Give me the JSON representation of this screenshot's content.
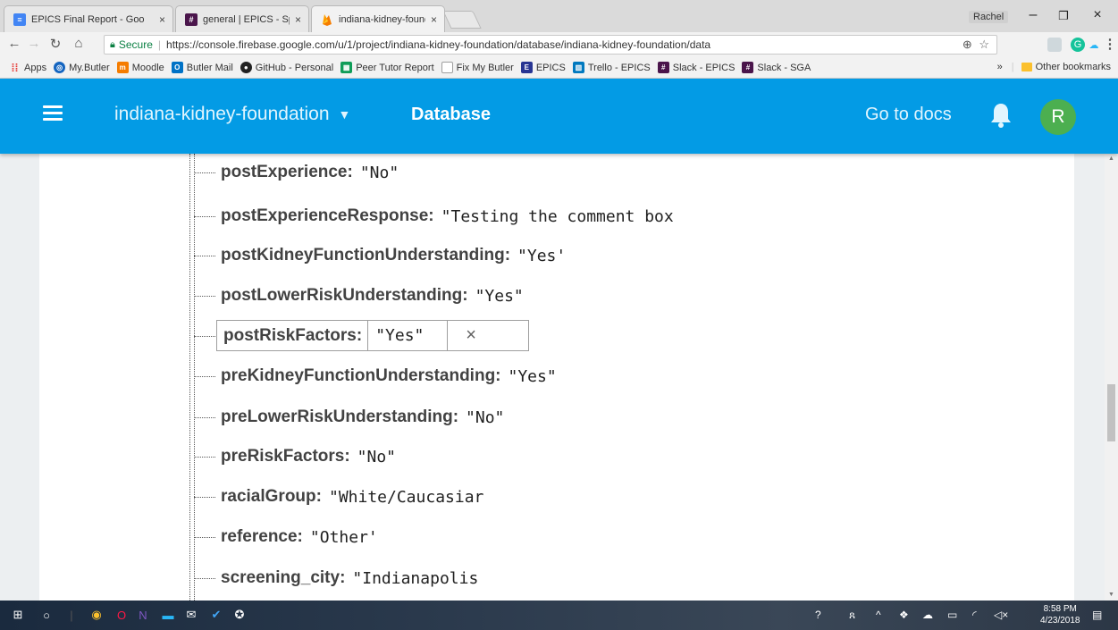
{
  "browser": {
    "tabs": [
      {
        "title": "EPICS Final Report - Goo",
        "favicon": "docs-icon",
        "color": "#4285f4"
      },
      {
        "title": "general | EPICS - Spring",
        "favicon": "slack-icon",
        "color": "#4a154b"
      },
      {
        "title": "indiana-kidney-foundatic",
        "favicon": "firebase-icon",
        "color": "#ffa000"
      }
    ],
    "profile_name": "Rachel",
    "address": {
      "secure_label": "Secure",
      "url": "https://console.firebase.google.com/u/1/project/indiana-kidney-foundation/database/indiana-kidney-foundation/data"
    },
    "bookmarks": [
      {
        "label": "Apps",
        "icon": "apps-grid-icon",
        "color": "#e53935"
      },
      {
        "label": "My.Butler",
        "icon": "mybutler-icon",
        "color": "#1565c0"
      },
      {
        "label": "Moodle",
        "icon": "moodle-icon",
        "color": "#f57c00"
      },
      {
        "label": "Butler Mail",
        "icon": "outlook-icon",
        "color": "#0072c6"
      },
      {
        "label": "GitHub - Personal",
        "icon": "github-icon",
        "color": "#222222"
      },
      {
        "label": "Peer Tutor Report",
        "icon": "sheets-icon",
        "color": "#0f9d58"
      },
      {
        "label": "Fix My Butler",
        "icon": "page-icon",
        "color": "#9e9e9e"
      },
      {
        "label": "EPICS",
        "icon": "epics-icon",
        "color": "#283593"
      },
      {
        "label": "Trello - EPICS",
        "icon": "trello-icon",
        "color": "#0079bf"
      },
      {
        "label": "Slack - EPICS",
        "icon": "slack-icon",
        "color": "#4a154b"
      },
      {
        "label": "Slack - SGA",
        "icon": "slack-icon",
        "color": "#4a154b"
      }
    ],
    "overflow_label": "»",
    "other_bookmarks": "Other bookmarks"
  },
  "firebase": {
    "project": "indiana-kidney-foundation",
    "section": "Database",
    "docs_link": "Go to docs",
    "avatar_initial": "R",
    "colors": {
      "header": "#039be5",
      "avatar": "#4caf50"
    }
  },
  "tree": {
    "rows": [
      {
        "key": "postExperience:",
        "value": "\"No\""
      },
      {
        "key": "postExperienceResponse:",
        "value": "\"Testing the comment box"
      },
      {
        "key": "postKidneyFunctionUnderstanding:",
        "value": "\"Yes'"
      },
      {
        "key": "postLowerRiskUnderstanding:",
        "value": "\"Yes\""
      },
      {
        "key": "postRiskFactors:",
        "value": "\"Yes\"",
        "editing": true
      },
      {
        "key": "preKidneyFunctionUnderstanding:",
        "value": "\"Yes\""
      },
      {
        "key": "preLowerRiskUnderstanding:",
        "value": "\"No\""
      },
      {
        "key": "preRiskFactors:",
        "value": "\"No\""
      },
      {
        "key": "racialGroup:",
        "value": "\"White/Caucasiar"
      },
      {
        "key": "reference:",
        "value": "\"Other'"
      },
      {
        "key": "screening_city:",
        "value": "\"Indianapolis"
      }
    ],
    "cancel_glyph": "×"
  },
  "taskbar": {
    "time": "8:58 PM",
    "date": "4/23/2018"
  }
}
